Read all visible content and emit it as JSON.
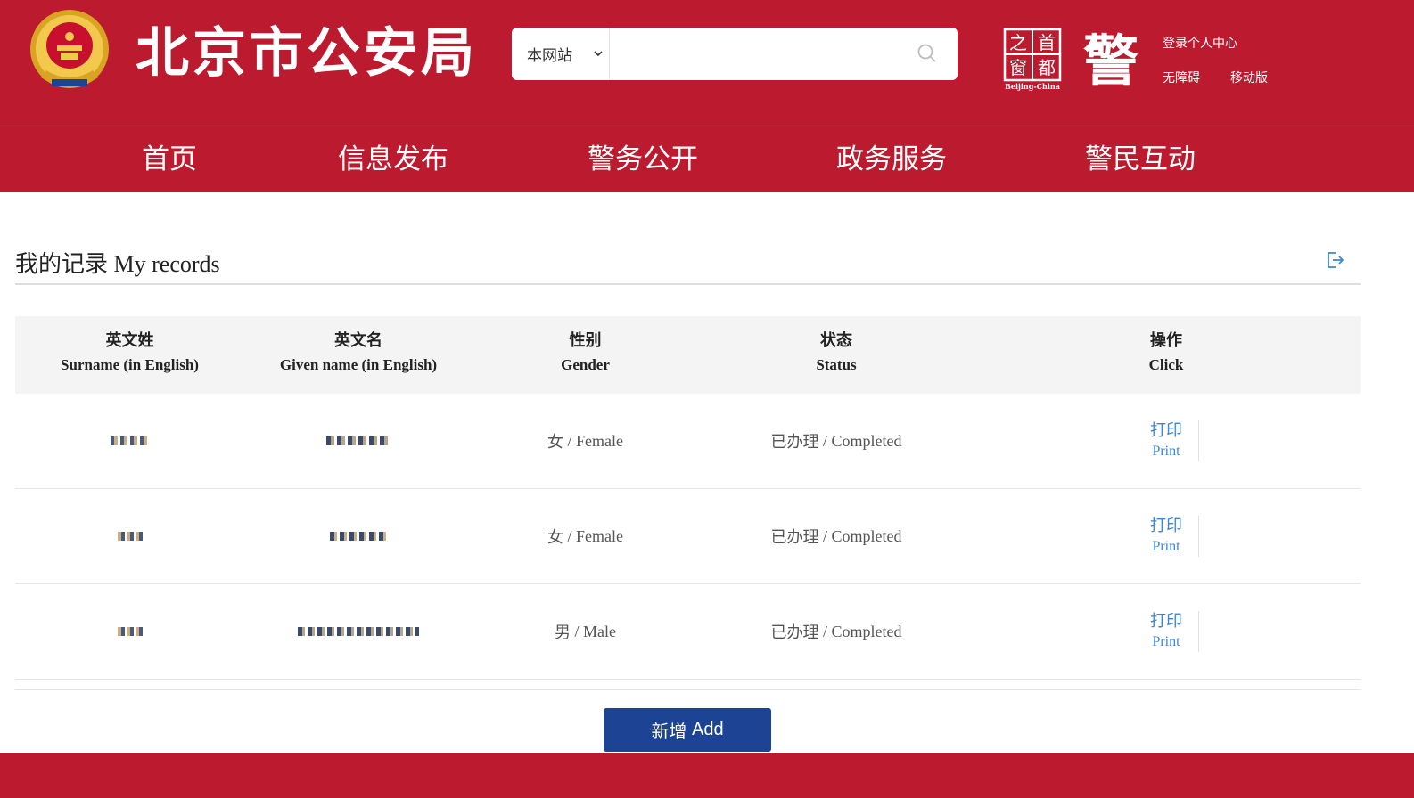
{
  "header": {
    "site_title": "北京市公安局",
    "search": {
      "scope": "本网站",
      "placeholder": "",
      "value": ""
    },
    "capital_seal_text": "之首窗都",
    "capital_seal_caption": "Beijing-China",
    "police_logo_text": "警",
    "links": {
      "login": "登录个人中心",
      "accessibility": "无障碍",
      "mobile": "移动版"
    }
  },
  "nav": {
    "items": [
      "首页",
      "信息发布",
      "警务公开",
      "政务服务",
      "警民互动"
    ]
  },
  "records": {
    "title_cn": "我的记录",
    "title_en": "My records"
  },
  "table": {
    "columns": [
      {
        "cn": "英文姓",
        "en": "Surname (in English)"
      },
      {
        "cn": "英文名",
        "en": "Given name (in English)"
      },
      {
        "cn": "性别",
        "en": "Gender"
      },
      {
        "cn": "状态",
        "en": "Status"
      },
      {
        "cn": "操作",
        "en": "Click"
      }
    ],
    "rows": [
      {
        "gender_cn": "女",
        "gender_en": "Female",
        "status_cn": "已办理",
        "status_en": "Completed",
        "action_cn": "打印",
        "action_en": "Print"
      },
      {
        "gender_cn": "女",
        "gender_en": "Female",
        "status_cn": "已办理",
        "status_en": "Completed",
        "action_cn": "打印",
        "action_en": "Print"
      },
      {
        "gender_cn": "男",
        "gender_en": "Male",
        "status_cn": "已办理",
        "status_en": "Completed",
        "action_cn": "打印",
        "action_en": "Print"
      }
    ]
  },
  "add_button": {
    "cn": "新增",
    "en": "Add"
  },
  "colors": {
    "brand_red": "#bc1a2e",
    "button_blue": "#1d4494",
    "link_blue": "#3d86d8",
    "header_gray": "#f4f4f4"
  },
  "icons": [
    "police-emblem-icon",
    "chevron-down-icon",
    "search-icon",
    "logout-icon"
  ]
}
